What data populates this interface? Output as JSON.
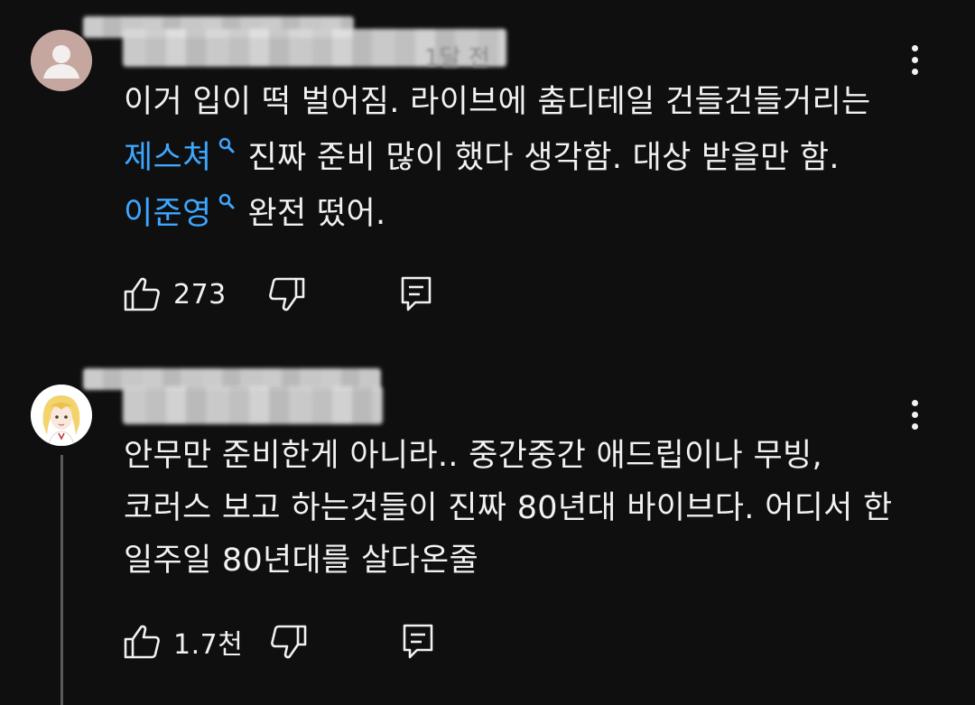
{
  "comments": [
    {
      "author_meta": "1달 전",
      "lines": [
        {
          "tag": "",
          "text": "이거 입이 떡 벌어짐. 라이브에 춤디테일 건들건들거리는"
        },
        {
          "tag": "제스쳐",
          "text": "진짜 준비 많이 했다 생각함. 대상 받을만 함."
        },
        {
          "tag": "이준영",
          "text": "완전 떴어."
        }
      ],
      "likes": "273",
      "avatar_icon": "default-person-avatar"
    },
    {
      "author_meta": "",
      "lines": [
        {
          "tag": "",
          "text": "안무만 준비한게 아니라.. 중간중간 애드립이나 무빙,"
        },
        {
          "tag": "",
          "text": "코러스 보고 하는것들이 진짜 80년대 바이브다. 어디서 한"
        },
        {
          "tag": "",
          "text": "일주일 80년대를 살다온줄"
        }
      ],
      "likes": "1.7천",
      "avatar_icon": "anime-character-avatar"
    }
  ],
  "icons": {
    "like": "thumbs-up-icon",
    "dislike": "thumbs-down-icon",
    "reply": "reply-comment-icon",
    "more": "more-vertical-icon",
    "tag_search": "search-icon"
  },
  "colors": {
    "background": "#0f0f0f",
    "text": "#f1f1f1",
    "tag": "#3ea6ff",
    "thread_line": "#5a5a5a"
  }
}
